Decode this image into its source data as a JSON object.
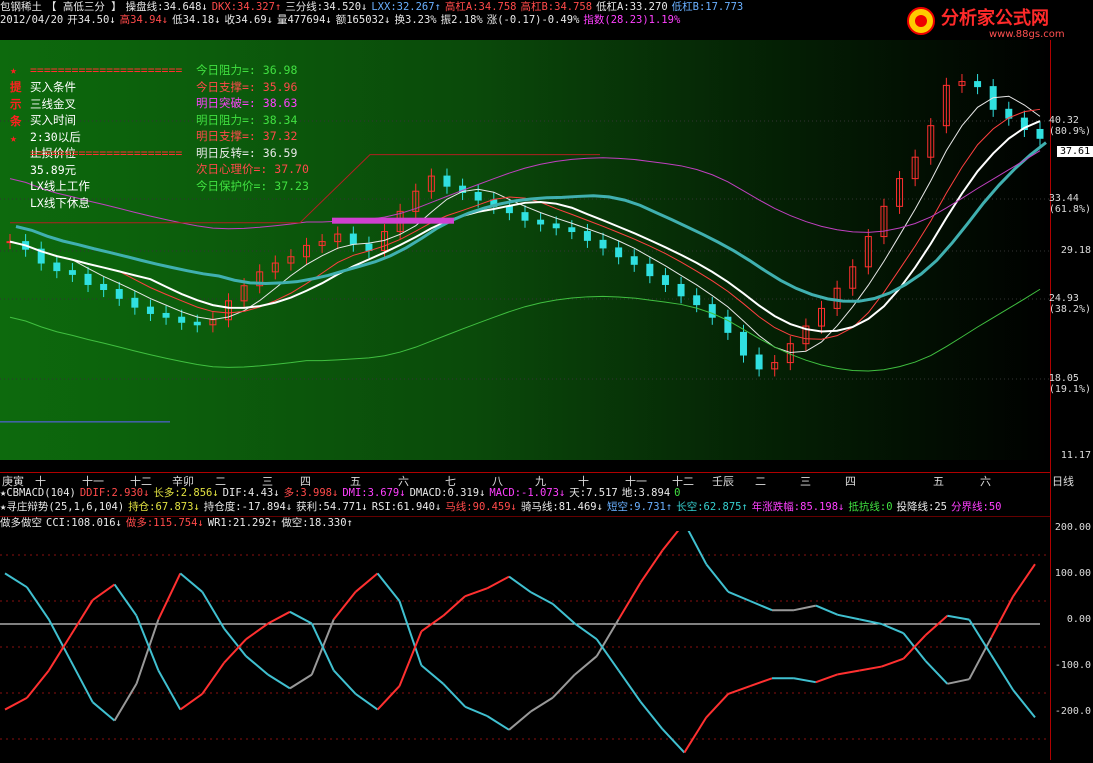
{
  "header": {
    "row1": [
      {
        "t": "包钢稀土",
        "c": "wh"
      },
      {
        "t": "【 高低三分 】",
        "c": "wh"
      },
      {
        "t": "操盘线:34.648↓",
        "c": "wh"
      },
      {
        "t": "DKX:34.327↑",
        "c": "up"
      },
      {
        "t": "三分线:34.520↓",
        "c": "wh"
      },
      {
        "t": "LXX:32.267↑",
        "c": "bl"
      },
      {
        "t": "高杠A:34.758",
        "c": "up"
      },
      {
        "t": "高杠B:34.758",
        "c": "up"
      },
      {
        "t": "低杠A:33.270",
        "c": "wh"
      },
      {
        "t": "低杠B:17.773",
        "c": "bl"
      }
    ],
    "row2": [
      {
        "t": "2012/04/20",
        "c": "wh"
      },
      {
        "t": "开34.50↓",
        "c": "wh"
      },
      {
        "t": "高34.94↓",
        "c": "up"
      },
      {
        "t": "低34.18↓",
        "c": "wh"
      },
      {
        "t": "收34.69↓",
        "c": "wh"
      },
      {
        "t": "量477694↓",
        "c": "wh"
      },
      {
        "t": "额165032↓",
        "c": "wh"
      },
      {
        "t": "换3.23%",
        "c": "wh"
      },
      {
        "t": "振2.18%",
        "c": "wh"
      },
      {
        "t": "涨(-0.17)-0.49%",
        "c": "wh"
      },
      {
        "t": "指数(28.23)1.19%",
        "c": "mg"
      }
    ]
  },
  "logo": {
    "title": "分析家公式网",
    "url": "www.88gs.com"
  },
  "buy_box": {
    "stars": [
      "★",
      "提",
      "示",
      "条",
      "★"
    ],
    "dashes": "======================",
    "rows": [
      {
        "k": "买入条件",
        "v": "三线金叉"
      },
      {
        "k": "买入时间",
        "v": "2:30以后"
      },
      {
        "k": "止损价位",
        "v": "35.89元"
      },
      {
        "k": "LX线上工作",
        "v": "LX线下休息"
      }
    ]
  },
  "levels": [
    {
      "t": "今日阻力=: 36.98",
      "c": "gr"
    },
    {
      "t": "今日支撑=: 35.96",
      "c": "up"
    },
    {
      "t": "明日突破=: 38.63",
      "c": "mg"
    },
    {
      "t": "明日阻力=: 38.34",
      "c": "gr"
    },
    {
      "t": "明日支撑=: 37.32",
      "c": "up"
    },
    {
      "t": "明日反转=: 36.59",
      "c": "wh"
    },
    {
      "t": "次日心理价=: 37.70",
      "c": "up"
    },
    {
      "t": "今日保护价=: 37.23",
      "c": "gr"
    }
  ],
  "price_axis": {
    "labels": [
      {
        "v": "40.32",
        "pct": "(80.9%)"
      },
      {
        "v": "33.44",
        "pct": "(61.8%)"
      },
      {
        "v": "29.18",
        "pct": ""
      },
      {
        "v": "24.93",
        "pct": "(38.2%)"
      },
      {
        "v": "18.05",
        "pct": "(19.1%)"
      },
      {
        "v": "11.17",
        "pct": ""
      }
    ],
    "current": "37.61"
  },
  "date_axis": {
    "labels": [
      "庚寅",
      "十",
      "十一",
      "十二",
      "辛卯",
      "二",
      "三",
      "四",
      "五",
      "六",
      "七",
      "八",
      "九",
      "十",
      "十一",
      "十二",
      "壬辰",
      "二",
      "三",
      "四",
      "五",
      "六"
    ],
    "period": "日线"
  },
  "sub1": {
    "row1": [
      {
        "t": "★CBMACD(104)",
        "c": "wh"
      },
      {
        "t": "DDIF:2.930↓",
        "c": "up"
      },
      {
        "t": "长多:2.856↓",
        "c": "yl"
      },
      {
        "t": "DIF:4.43↓",
        "c": "wh"
      },
      {
        "t": "多:3.998↓",
        "c": "up"
      },
      {
        "t": "DMI:3.679↓",
        "c": "mg"
      },
      {
        "t": "DMACD:0.319↓",
        "c": "wh"
      },
      {
        "t": "MACD:-1.073↓",
        "c": "mg"
      },
      {
        "t": "天:7.517",
        "c": "wh"
      },
      {
        "t": "地:3.894",
        "c": "wh"
      },
      {
        "t": "0",
        "c": "gr"
      }
    ],
    "row2": [
      {
        "t": "★寻庄辩势(25,1,6,104)",
        "c": "wh"
      },
      {
        "t": "持仓:67.873↓",
        "c": "yl"
      },
      {
        "t": "持仓度:-17.894↓",
        "c": "wh"
      },
      {
        "t": "获利:54.771↓",
        "c": "wh"
      },
      {
        "t": "RSI:61.940↓",
        "c": "wh"
      },
      {
        "t": "马线:90.459↓",
        "c": "up"
      },
      {
        "t": "骑马线:81.469↓",
        "c": "wh"
      },
      {
        "t": "短空:9.731↑",
        "c": "bl"
      },
      {
        "t": "长空:62.875↑",
        "c": "dn"
      },
      {
        "t": "年涨跌幅:85.198↓",
        "c": "mg"
      },
      {
        "t": "抵抗线:0",
        "c": "gr"
      },
      {
        "t": "投降线:25",
        "c": "wh"
      },
      {
        "t": "分界线:50",
        "c": "mg"
      }
    ]
  },
  "sub2": {
    "row": [
      {
        "t": "做多做空",
        "c": "wh"
      },
      {
        "t": "CCI:108.016↓",
        "c": "wh"
      },
      {
        "t": "做多:115.754↓",
        "c": "up"
      },
      {
        "t": "WR1:21.292↑",
        "c": "wh"
      },
      {
        "t": "做空:18.330↑",
        "c": "wh"
      }
    ],
    "axis": [
      "200.00",
      "100.00",
      "0.00",
      "-100.0",
      "-200.0"
    ]
  },
  "chart_data": {
    "type": "line",
    "price_close": [
      28.5,
      27.9,
      26.8,
      26.2,
      25.9,
      25.1,
      24.7,
      24.0,
      23.3,
      22.8,
      22.5,
      22.1,
      21.9,
      22.3,
      23.8,
      25.0,
      26.1,
      26.8,
      27.3,
      28.2,
      28.5,
      29.1,
      28.3,
      27.8,
      29.3,
      30.9,
      32.5,
      33.7,
      32.9,
      32.4,
      31.8,
      31.3,
      30.8,
      30.2,
      29.9,
      29.6,
      29.3,
      28.6,
      28.0,
      27.3,
      26.7,
      25.8,
      25.1,
      24.2,
      23.5,
      22.5,
      21.3,
      19.5,
      18.4,
      18.9,
      20.4,
      21.8,
      23.2,
      24.8,
      26.5,
      28.9,
      31.3,
      33.5,
      35.2,
      37.7,
      40.9,
      41.2,
      40.8,
      39.0,
      38.3,
      37.4,
      36.7
    ],
    "cci": [
      160,
      130,
      60,
      -30,
      -120,
      -160,
      -80,
      60,
      160,
      120,
      40,
      -20,
      -60,
      -90,
      -60,
      60,
      120,
      160,
      100,
      -40,
      -80,
      -130,
      -150,
      -180,
      -140,
      -110,
      -60,
      -20,
      60,
      140,
      210,
      270,
      180,
      120,
      100,
      80,
      80,
      90,
      70,
      60,
      50,
      30,
      -30,
      -80,
      -70,
      20,
      110,
      180
    ]
  }
}
